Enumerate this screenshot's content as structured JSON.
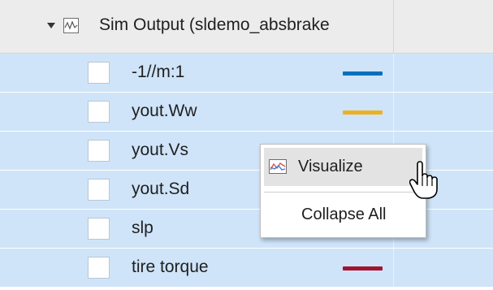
{
  "run": {
    "label": "Sim Output (sldemo_absbrake",
    "icon": "line-chart-run-icon"
  },
  "signals": [
    {
      "label": "-1//m:1",
      "color": "#0072bd",
      "checked": false
    },
    {
      "label": "yout.Ww",
      "color": "#edb120",
      "checked": false
    },
    {
      "label": "yout.Vs",
      "color": "#77ac30",
      "checked": false
    },
    {
      "label": "yout.Sd",
      "color": "#7e2f8e",
      "checked": false
    },
    {
      "label": "slp",
      "color": "#4dbeee",
      "checked": false
    },
    {
      "label": "tire torque",
      "color": "#a2142f",
      "checked": false
    }
  ],
  "context_menu": {
    "visualize_label": "Visualize",
    "visualize_icon": "visualize-plot-icon",
    "collapse_all_label": "Collapse All"
  },
  "cursor": "hand-pointer-icon"
}
